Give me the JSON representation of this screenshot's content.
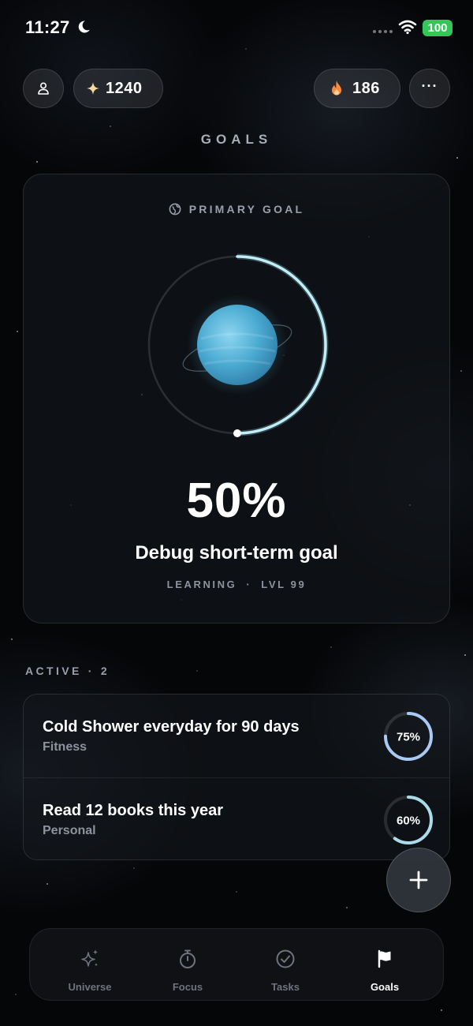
{
  "status_bar": {
    "time": "11:27",
    "battery": "100"
  },
  "header": {
    "points": "1240",
    "streak": "186",
    "page_title": "GOALS"
  },
  "primary_goal": {
    "label": "PRIMARY GOAL",
    "percent_text": "50%",
    "progress": 0.5,
    "title": "Debug short-term goal",
    "category": "LEARNING",
    "separator": "·",
    "level": "LVL 99"
  },
  "active": {
    "label": "ACTIVE",
    "separator": "·",
    "count": "2",
    "goals": [
      {
        "title": "Cold Shower everyday for 90 days",
        "category": "Fitness",
        "percent_text": "75%",
        "progress": 0.75
      },
      {
        "title": "Read 12 books this year",
        "category": "Personal",
        "percent_text": "60%",
        "progress": 0.6
      }
    ]
  },
  "tabs": [
    {
      "label": "Universe",
      "icon": "sparkles-icon"
    },
    {
      "label": "Focus",
      "icon": "stopwatch-icon"
    },
    {
      "label": "Tasks",
      "icon": "checkmark-circle-icon"
    },
    {
      "label": "Goals",
      "icon": "flag-icon",
      "active": true
    }
  ],
  "colors": {
    "accent": "#a9e6f3",
    "battery": "#33c759",
    "streak": "#ff8a3d",
    "points": "#f6d9a0"
  }
}
